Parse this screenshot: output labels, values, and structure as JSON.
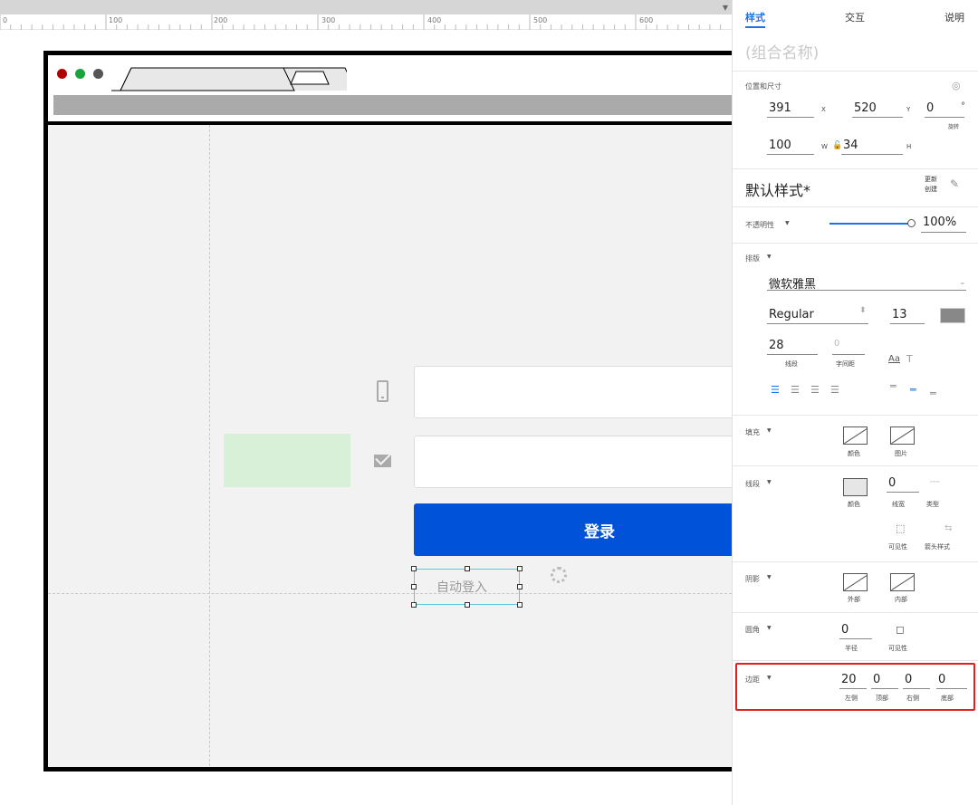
{
  "ruler": {
    "labels": [
      "0",
      "100",
      "200",
      "300",
      "400",
      "500",
      "600"
    ]
  },
  "canvas": {
    "login_button_label": "登录",
    "auto_login_label": "自动登入"
  },
  "panel": {
    "tabs": [
      "样式",
      "交互",
      "说明"
    ],
    "group_name": "(组合名称)",
    "position_size": {
      "label": "位置和尺寸",
      "x": "391",
      "x_label": "X",
      "y": "520",
      "y_label": "Y",
      "rotation": "0",
      "rotation_unit": "°",
      "rotation_label": "旋转",
      "w": "100",
      "w_label": "W",
      "h": "34",
      "h_label": "H"
    },
    "style": {
      "title": "默认样式*",
      "update_label": "更新",
      "create_label": "创建"
    },
    "opacity": {
      "label": "不透明性",
      "value": "100%",
      "level": 1.0
    },
    "typography": {
      "label": "排版",
      "font": "微软雅黑",
      "weight": "Regular",
      "size": "13",
      "line_height": "28",
      "line_height_label": "线段",
      "letter_spacing": "0",
      "letter_spacing_label": "字间距",
      "color": "#888888"
    },
    "fill": {
      "label": "填充",
      "color_label": "颜色",
      "image_label": "图片"
    },
    "stroke": {
      "label": "线段",
      "color_label": "颜色",
      "width": "0",
      "width_label": "线宽",
      "type_label": "类型",
      "visibility_label": "可见性",
      "arrow_label": "箭头样式"
    },
    "shadow": {
      "label": "阴影",
      "outer_label": "外部",
      "inner_label": "内部"
    },
    "corner": {
      "label": "圆角",
      "radius": "0",
      "radius_label": "半径",
      "visibility_label": "可见性"
    },
    "padding": {
      "label": "边距",
      "left": "20",
      "left_label": "左侧",
      "top": "0",
      "top_label": "顶部",
      "right": "0",
      "right_label": "右侧",
      "bottom": "0",
      "bottom_label": "底部"
    }
  },
  "colors": {
    "accent": "#1a73e8",
    "login_button": "#0052d9",
    "highlight": "#e02020"
  }
}
